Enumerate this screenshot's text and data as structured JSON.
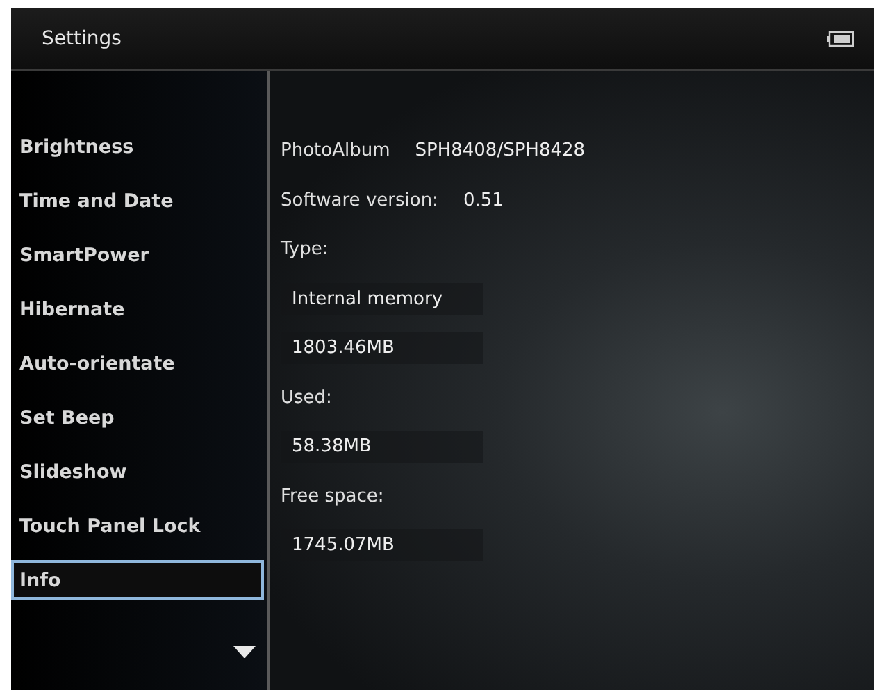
{
  "header": {
    "title": "Settings"
  },
  "menu": [
    {
      "label": "Brightness",
      "selected": false
    },
    {
      "label": "Time and Date",
      "selected": false
    },
    {
      "label": "SmartPower",
      "selected": false
    },
    {
      "label": "Hibernate",
      "selected": false
    },
    {
      "label": "Auto-orientate",
      "selected": false
    },
    {
      "label": "Set Beep",
      "selected": false
    },
    {
      "label": "Slideshow",
      "selected": false
    },
    {
      "label": "Touch Panel Lock",
      "selected": false
    },
    {
      "label": "Info",
      "selected": true
    }
  ],
  "info": [
    {
      "label": "PhotoAlbum",
      "value": "SPH8408/SPH8428"
    },
    {
      "label": "Software version:",
      "value": "0.51"
    },
    {
      "label": "Type:"
    },
    {
      "value": "Internal memory"
    },
    {
      "value": "1803.46MB"
    },
    {
      "label": "Used:"
    },
    {
      "value": "58.38MB"
    },
    {
      "label": "Free space:"
    },
    {
      "value": "1745.07MB"
    }
  ]
}
